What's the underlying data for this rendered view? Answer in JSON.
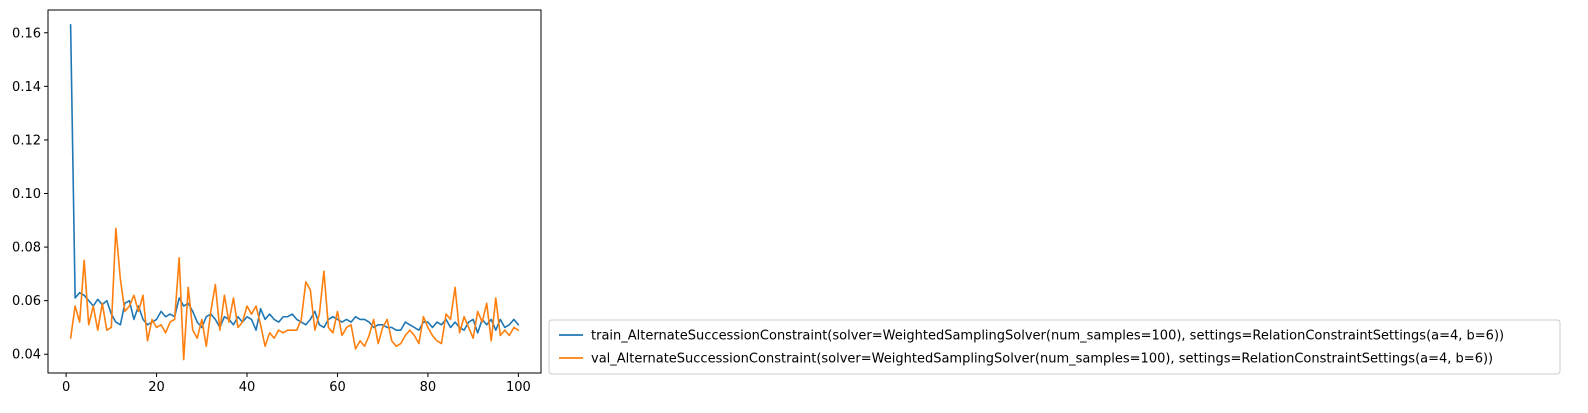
{
  "chart_data": {
    "type": "line",
    "title": "",
    "xlabel": "",
    "ylabel": "",
    "xlim": [
      -4,
      105
    ],
    "ylim": [
      0.033,
      0.1685
    ],
    "xticks": [
      0,
      20,
      40,
      60,
      80,
      100
    ],
    "xtick_labels": [
      "0",
      "20",
      "40",
      "60",
      "80",
      "100"
    ],
    "yticks": [
      0.04,
      0.06,
      0.08,
      0.1,
      0.12,
      0.14,
      0.16
    ],
    "ytick_labels": [
      "0.04",
      "0.06",
      "0.08",
      "0.10",
      "0.12",
      "0.14",
      "0.16"
    ],
    "grid": false,
    "legend_position": "outside-right-bottom",
    "x": [
      1,
      2,
      3,
      4,
      5,
      6,
      7,
      8,
      9,
      10,
      11,
      12,
      13,
      14,
      15,
      16,
      17,
      18,
      19,
      20,
      21,
      22,
      23,
      24,
      25,
      26,
      27,
      28,
      29,
      30,
      31,
      32,
      33,
      34,
      35,
      36,
      37,
      38,
      39,
      40,
      41,
      42,
      43,
      44,
      45,
      46,
      47,
      48,
      49,
      50,
      51,
      52,
      53,
      54,
      55,
      56,
      57,
      58,
      59,
      60,
      61,
      62,
      63,
      64,
      65,
      66,
      67,
      68,
      69,
      70,
      71,
      72,
      73,
      74,
      75,
      76,
      77,
      78,
      79,
      80,
      81,
      82,
      83,
      84,
      85,
      86,
      87,
      88,
      89,
      90,
      91,
      92,
      93,
      94,
      95,
      96,
      97,
      98,
      99,
      100
    ],
    "series": [
      {
        "name": "train_AlternateSuccessionConstraint(solver=WeightedSamplingSolver(num_samples=100), settings=RelationConstraintSettings(a=4, b=6))",
        "color": "#1f77b4",
        "values": [
          0.163,
          0.061,
          0.063,
          0.062,
          0.06,
          0.058,
          0.0605,
          0.0585,
          0.06,
          0.055,
          0.052,
          0.051,
          0.059,
          0.06,
          0.053,
          0.058,
          0.053,
          0.051,
          0.052,
          0.053,
          0.056,
          0.054,
          0.055,
          0.054,
          0.061,
          0.058,
          0.059,
          0.056,
          0.052,
          0.05,
          0.054,
          0.055,
          0.053,
          0.05,
          0.054,
          0.053,
          0.051,
          0.054,
          0.052,
          0.054,
          0.053,
          0.049,
          0.057,
          0.053,
          0.055,
          0.053,
          0.052,
          0.054,
          0.054,
          0.055,
          0.053,
          0.052,
          0.051,
          0.053,
          0.056,
          0.051,
          0.05,
          0.053,
          0.054,
          0.053,
          0.052,
          0.053,
          0.052,
          0.054,
          0.053,
          0.053,
          0.052,
          0.05,
          0.051,
          0.051,
          0.05,
          0.05,
          0.049,
          0.049,
          0.052,
          0.051,
          0.05,
          0.049,
          0.052,
          0.052,
          0.05,
          0.052,
          0.051,
          0.053,
          0.05,
          0.052,
          0.05,
          0.049,
          0.052,
          0.053,
          0.048,
          0.053,
          0.051,
          0.053,
          0.049,
          0.053,
          0.05,
          0.051,
          0.053,
          0.051
        ]
      },
      {
        "name": "val_AlternateSuccessionConstraint(solver=WeightedSamplingSolver(num_samples=100), settings=RelationConstraintSettings(a=4, b=6))",
        "color": "#ff7f0e",
        "values": [
          0.046,
          0.058,
          0.052,
          0.075,
          0.051,
          0.058,
          0.049,
          0.059,
          0.049,
          0.05,
          0.087,
          0.068,
          0.056,
          0.058,
          0.062,
          0.056,
          0.062,
          0.045,
          0.053,
          0.05,
          0.051,
          0.048,
          0.052,
          0.053,
          0.076,
          0.038,
          0.065,
          0.049,
          0.046,
          0.053,
          0.043,
          0.056,
          0.066,
          0.049,
          0.062,
          0.052,
          0.061,
          0.05,
          0.052,
          0.058,
          0.055,
          0.058,
          0.051,
          0.043,
          0.048,
          0.046,
          0.049,
          0.048,
          0.049,
          0.049,
          0.049,
          0.053,
          0.067,
          0.064,
          0.049,
          0.055,
          0.071,
          0.05,
          0.048,
          0.056,
          0.047,
          0.05,
          0.051,
          0.042,
          0.045,
          0.043,
          0.047,
          0.053,
          0.044,
          0.05,
          0.053,
          0.045,
          0.043,
          0.044,
          0.047,
          0.049,
          0.047,
          0.044,
          0.054,
          0.05,
          0.047,
          0.045,
          0.044,
          0.055,
          0.053,
          0.065,
          0.048,
          0.054,
          0.05,
          0.046,
          0.056,
          0.052,
          0.059,
          0.045,
          0.061,
          0.047,
          0.049,
          0.047,
          0.05,
          0.049
        ]
      }
    ]
  }
}
